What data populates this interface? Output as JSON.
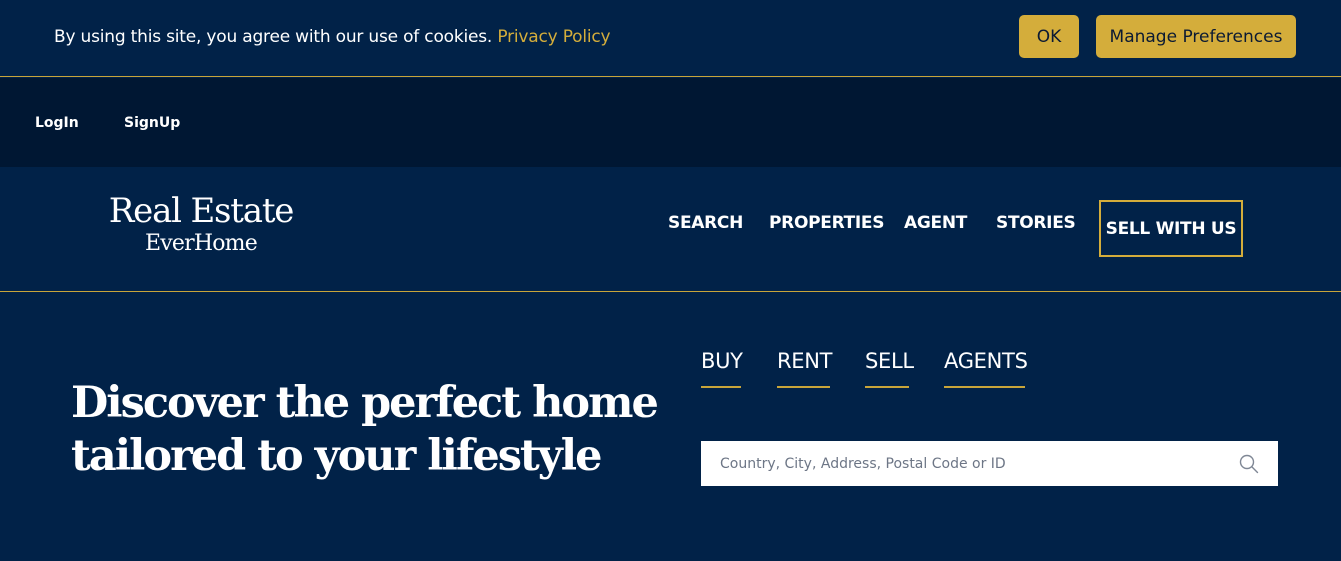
{
  "cookie": {
    "message": "By using this site, you agree with our use of cookies.",
    "policy_link": "Privacy Policy",
    "ok_label": "OK",
    "prefs_label": "Manage Preferences"
  },
  "auth": {
    "login": "LogIn",
    "signup": "SignUp"
  },
  "logo": {
    "main": "Real Estate",
    "sub": "EverHome"
  },
  "nav": {
    "search": "SEARCH",
    "properties": "PROPERTIES",
    "agent": "AGENT",
    "stories": "STORIES",
    "sell": "SELL WITH US"
  },
  "hero": {
    "title_line1": "Discover the perfect home",
    "title_line2": "tailored to your lifestyle"
  },
  "tabs": {
    "buy": "BUY",
    "rent": "RENT",
    "sell": "SELL",
    "agents": "AGENTS"
  },
  "search": {
    "placeholder": "Country, City, Address, Postal Code or ID",
    "value": "",
    "icon": "search-icon"
  },
  "colors": {
    "background": "#012248",
    "auth_bar": "#001733",
    "accent_gold": "#d4ad3b"
  }
}
